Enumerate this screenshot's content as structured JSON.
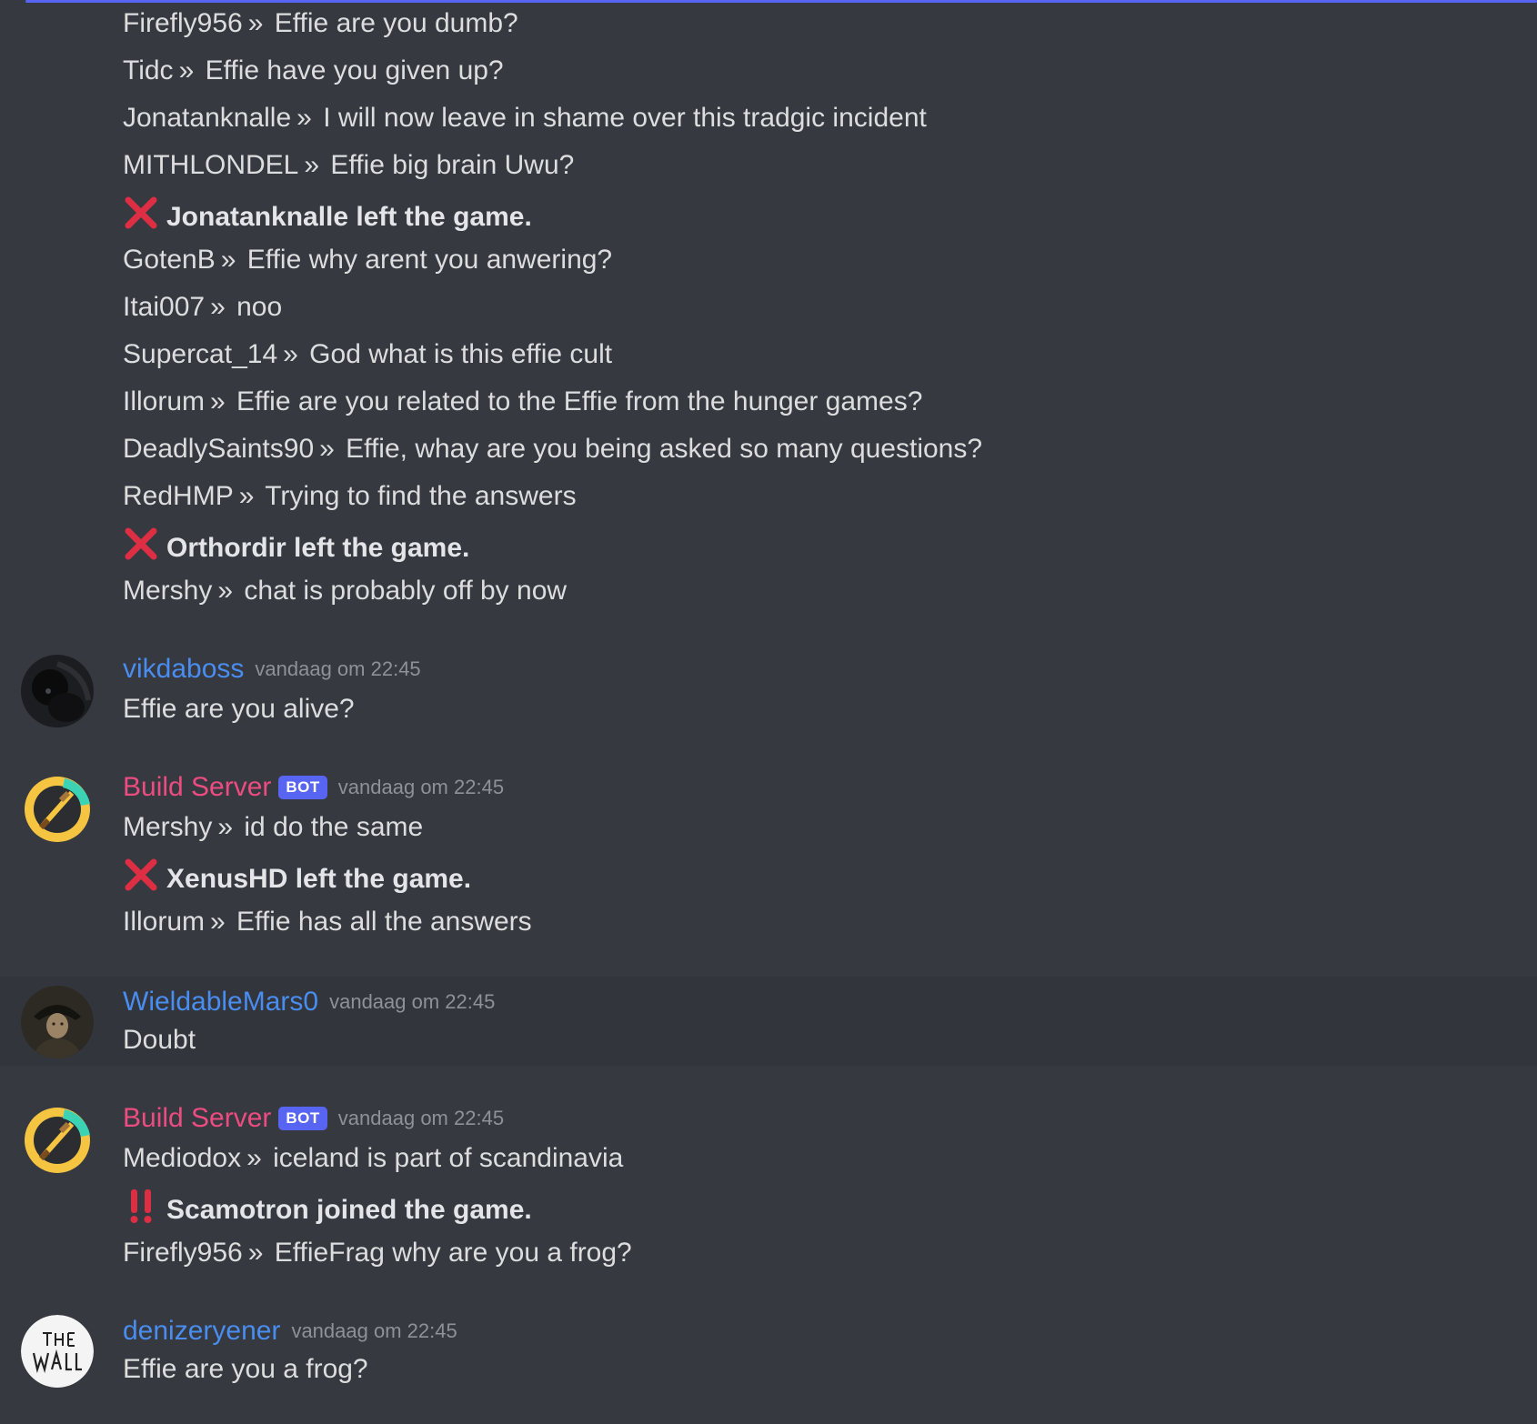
{
  "top_lines": [
    {
      "sender": "Firefly956",
      "text": "Effie are you dumb?"
    },
    {
      "sender": "Tidc",
      "text": "Effie have you given up?"
    },
    {
      "sender": "Jonatanknalle",
      "text": "I will now leave in shame over this tradgic incident"
    },
    {
      "sender": "MITHLONDEL",
      "text": "Effie big brain Uwu?"
    },
    {
      "system": "Jonatanknalle left the game.",
      "icon": "cross-mark-icon"
    },
    {
      "sender": "GotenB",
      "text": "Effie why arent you anwering?"
    },
    {
      "sender": "Itai007",
      "text": "noo"
    },
    {
      "sender": "Supercat_14",
      "text": "God what is this effie cult"
    },
    {
      "sender": "Illorum",
      "text": "Effie are you related to the Effie from the hunger games?"
    },
    {
      "sender": "DeadlySaints90",
      "text": "Effie, whay are you being asked so many questions?"
    },
    {
      "sender": "RedHMP",
      "text": "Trying to find the answers"
    },
    {
      "system": "Orthordir left the game.",
      "icon": "cross-mark-icon"
    },
    {
      "sender": "Mershy",
      "text": "chat is probably off by now"
    }
  ],
  "separator": "»",
  "messages": [
    {
      "author": "vikdaboss",
      "timestamp": "vandaag om 22:45",
      "avatar": "black-cat-avatar",
      "lines": [
        {
          "text": "Effie are you alive?"
        }
      ]
    },
    {
      "author": "Build Server",
      "bot_tag": "BOT",
      "timestamp": "vandaag om 22:45",
      "avatar": "minecraft-pickaxe-avatar",
      "lines": [
        {
          "sender": "Mershy",
          "text": "id do the same"
        },
        {
          "system": "XenusHD left the game.",
          "icon": "cross-mark-icon"
        },
        {
          "sender": "Illorum",
          "text": "Effie has all the answers"
        }
      ]
    },
    {
      "author": "WieldableMars0",
      "timestamp": "vandaag om 22:45",
      "avatar": "portrait-avatar",
      "lines": [
        {
          "text": "Doubt"
        }
      ]
    },
    {
      "author": "Build Server",
      "bot_tag": "BOT",
      "timestamp": "vandaag om 22:45",
      "avatar": "minecraft-pickaxe-avatar",
      "lines": [
        {
          "sender": "Mediodox",
          "text": "iceland is part of scandinavia"
        },
        {
          "system": "Scamotron joined the game.",
          "icon": "double-exclamation-icon"
        },
        {
          "sender": "Firefly956",
          "text": "EffieFrag why are you a frog?"
        }
      ]
    },
    {
      "author": "denizeryener",
      "timestamp": "vandaag om 22:45",
      "avatar": "the-wall-avatar",
      "lines": [
        {
          "text": "Effie are you a frog?"
        }
      ]
    }
  ],
  "colors": {
    "background": "#36393f",
    "hover_background": "#32353b",
    "user_name": "#4a8df0",
    "bot_name": "#ec4c80",
    "bot_tag": "#5865f2",
    "timestamp": "#8e9297",
    "cross_mark": "#dd2e44"
  }
}
